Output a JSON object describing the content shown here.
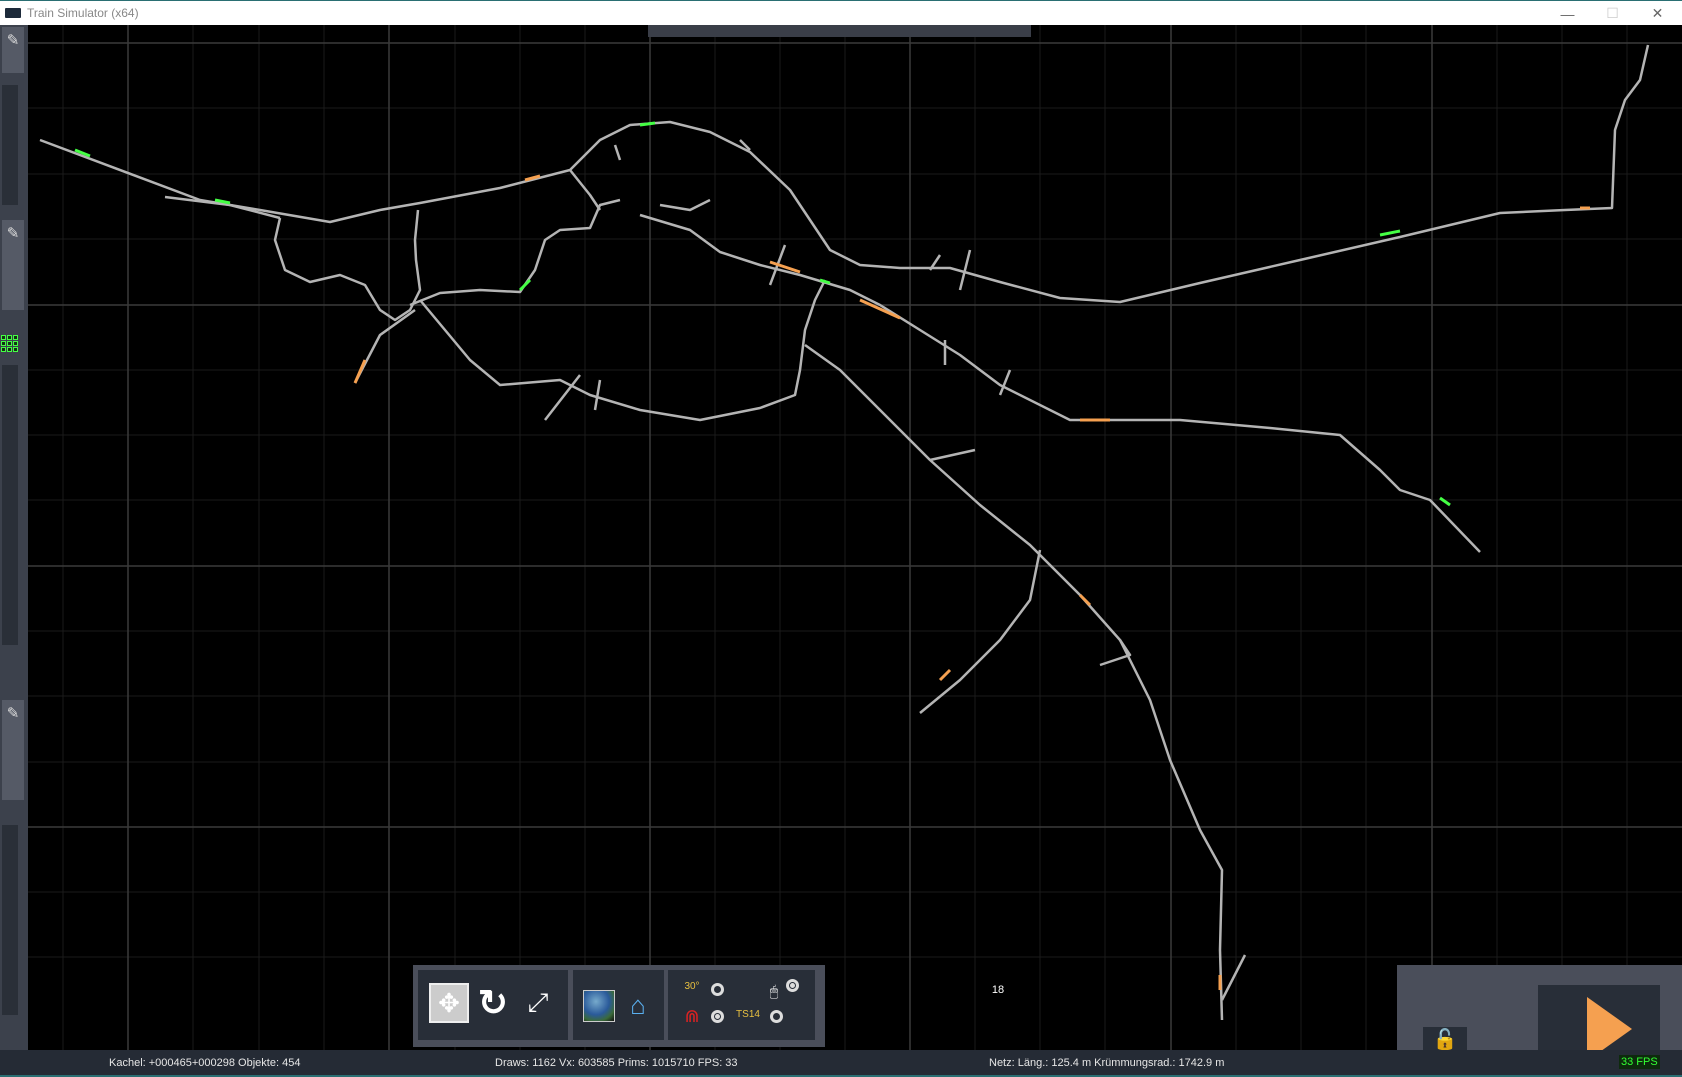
{
  "window": {
    "title": "Train Simulator (x64)",
    "minimize": "—",
    "maximize": "☐",
    "close": "✕"
  },
  "toolbar": {
    "number_value": "18",
    "label_30": "30°",
    "label_ts14": "TS14"
  },
  "status": {
    "tile": "Kachel: +000465+000298  Objekte: 454",
    "stats": "Draws: 1162 Vx: 603585 Prims: 1015710 FPS: 33",
    "net": "Netz:  Läng.:  125.4 m Krümmungsrad.: 1742.9 m"
  },
  "fps": "33 FPS",
  "colors": {
    "track": "#b4b4b4",
    "accent_green": "#44ff44",
    "accent_orange": "#f5a050"
  }
}
